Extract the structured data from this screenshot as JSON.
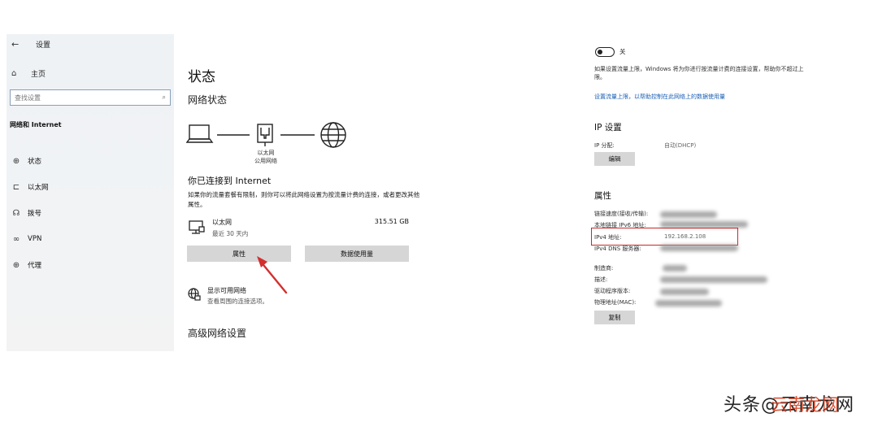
{
  "sidebar": {
    "back_icon": "back-arrow-icon",
    "title": "设置",
    "home_label": "主页",
    "search_placeholder": "查找设置",
    "section_title": "网络和 Internet",
    "items": [
      {
        "label": "状态",
        "icon": "status-icon"
      },
      {
        "label": "以太网",
        "icon": "ethernet-icon"
      },
      {
        "label": "拨号",
        "icon": "dialup-icon"
      },
      {
        "label": "VPN",
        "icon": "vpn-icon"
      },
      {
        "label": "代理",
        "icon": "proxy-icon"
      }
    ]
  },
  "status": {
    "page_title": "状态",
    "network_status_title": "网络状态",
    "diagram_label_line1": "以太网",
    "diagram_label_line2": "公用网络",
    "connected_title": "你已连接到 Internet",
    "connected_desc": "如果你的流量套餐有限制，则你可以将此网络设置为按流量计费的连接，或者更改其他属性。",
    "ethernet_name": "以太网",
    "ethernet_time": "最近 30 天内",
    "ethernet_usage": "315.51 GB",
    "properties_button": "属性",
    "data_usage_button": "数据使用量",
    "show_available_title": "显示可用网络",
    "show_available_desc": "查看周围的连接选项。",
    "advanced_title": "高级网络设置"
  },
  "properties_page": {
    "toggle_label": "关",
    "limit_desc": "如果设置流量上限，Windows 将为你进行按流量计费的连接设置，帮助你不超过上限。",
    "limit_link": "设置流量上限，以帮助控制在此网络上的数据使用量",
    "ip_settings_title": "IP 设置",
    "ip_assign_label": "IP 分配:",
    "ip_assign_value": "自动(DHCP)",
    "edit_button": "编辑",
    "properties_title": "属性",
    "link_speed_label": "链接速度(接收/传输):",
    "ipv6_label": "本地链接 IPv6 地址:",
    "ipv4_label": "IPv4 地址:",
    "ipv4_value": "192.168.2.108",
    "dns_label": "IPv4 DNS 服务器:",
    "manufacturer_label": "制造商:",
    "description_label": "描述:",
    "driver_label": "驱动程序版本:",
    "mac_label": "物理地址(MAC):",
    "copy_button": "复制",
    "highlight_color": "#c62828"
  },
  "watermark": {
    "text": "头条@云南龙网",
    "overlay_text": "云南龙网",
    "overlay_color": "#d63a1a"
  }
}
